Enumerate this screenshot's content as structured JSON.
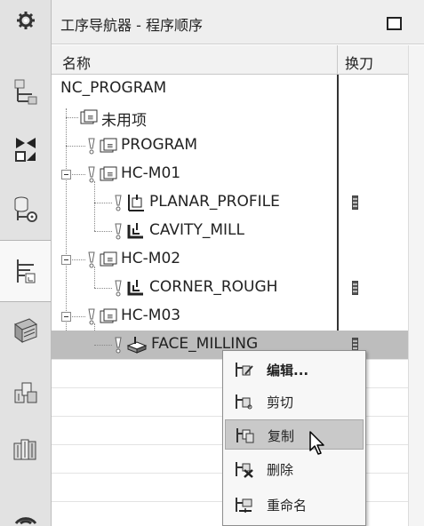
{
  "panel": {
    "title": "工序导航器 - 程序顺序",
    "columns": {
      "name": "名称",
      "tool": "换刀"
    }
  },
  "tree": {
    "root": "NC_PROGRAM",
    "unused": "未用项",
    "program": "PROGRAM",
    "groups": [
      {
        "name": "HC-M01",
        "ops": [
          "PLANAR_PROFILE",
          "CAVITY_MILL"
        ]
      },
      {
        "name": "HC-M02",
        "ops": [
          "CORNER_ROUGH"
        ]
      },
      {
        "name": "HC-M03",
        "ops": [
          "FACE_MILLING"
        ]
      }
    ]
  },
  "context_menu": {
    "items": [
      {
        "label": "编辑...",
        "icon": "edit-icon"
      },
      {
        "label": "剪切",
        "icon": "cut-icon"
      },
      {
        "label": "复制",
        "icon": "copy-icon"
      },
      {
        "label": "删除",
        "icon": "delete-icon"
      },
      {
        "label": "重命名",
        "icon": "rename-icon"
      }
    ],
    "hovered_index": 2
  },
  "rail_icons": [
    "settings-icon",
    "assembly-navigator-icon",
    "constraint-navigator-icon",
    "part-navigator-icon",
    "operation-navigator-icon",
    "machine-tool-navigator-icon",
    "reuse-library-icon",
    "history-icon",
    "palette-icon",
    "web-icon"
  ],
  "colors": {
    "selection": "#bdbdbd",
    "menu_hover": "#c9c9c9",
    "tree_line": "#333333"
  }
}
